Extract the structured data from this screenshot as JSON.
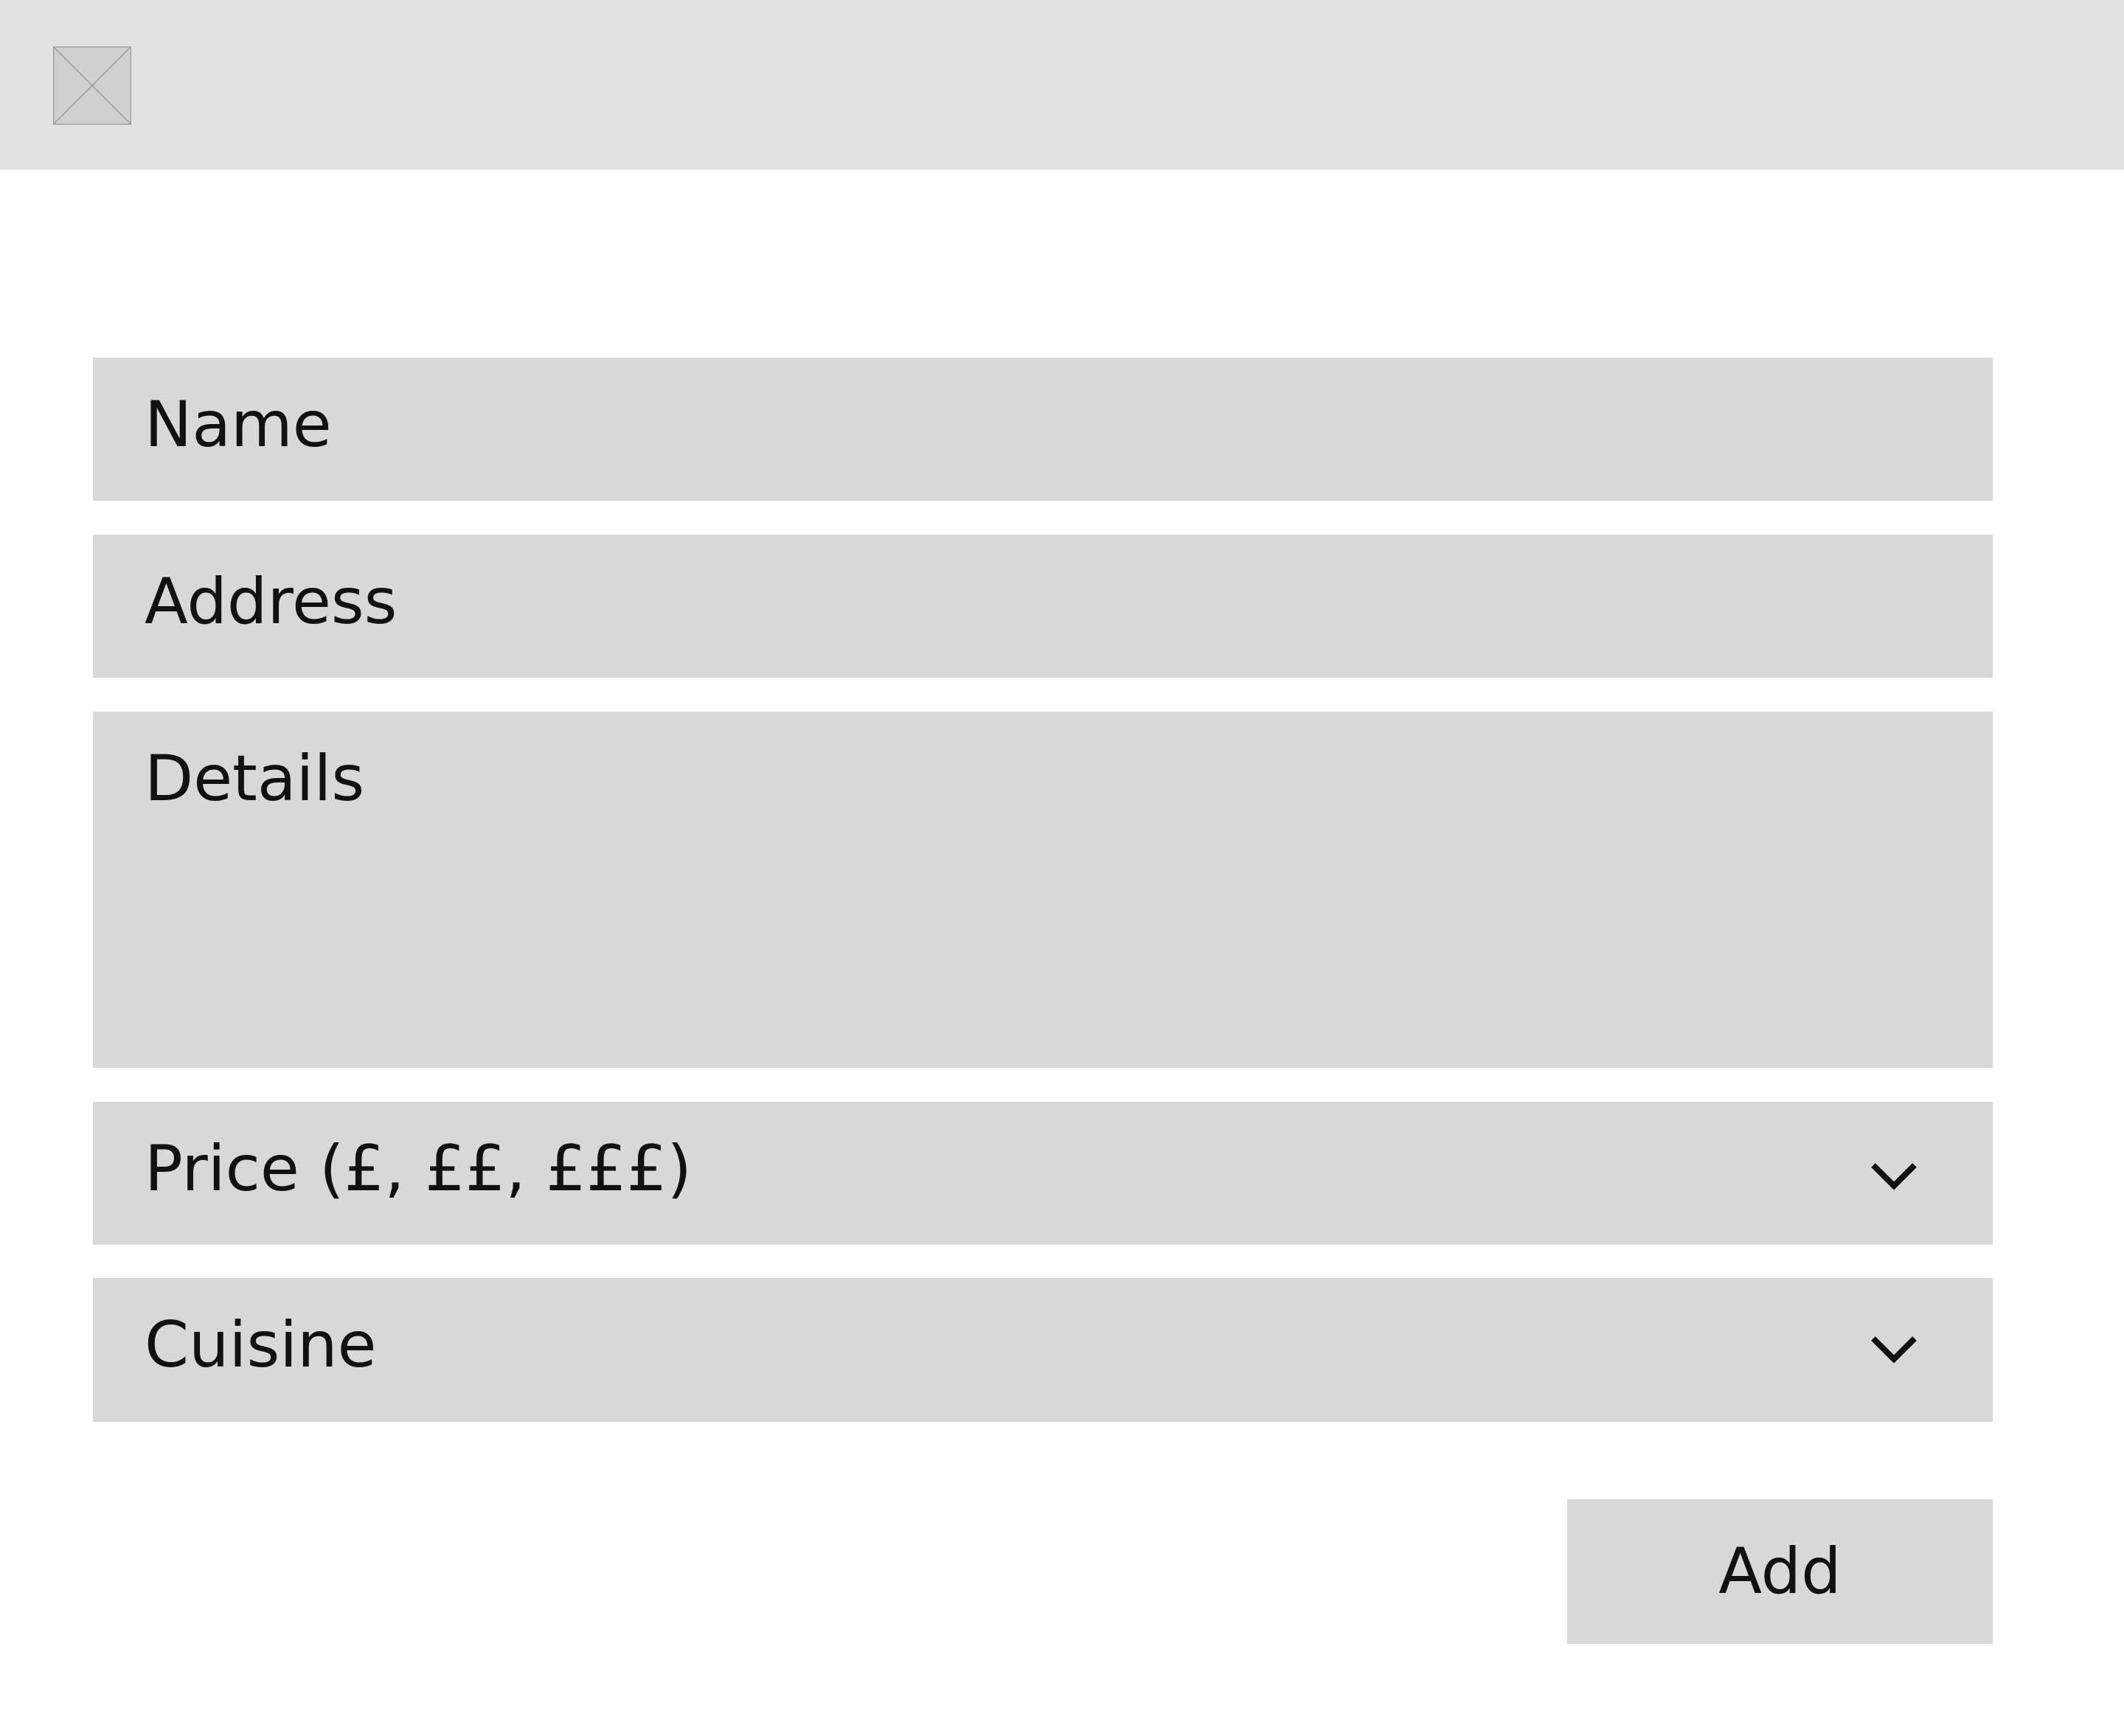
{
  "header": {
    "logo_icon": "image-placeholder-icon"
  },
  "form": {
    "name_placeholder": "Name",
    "address_placeholder": "Address",
    "details_placeholder": "Details",
    "price_placeholder": "Price (£, ££, £££)",
    "cuisine_placeholder": "Cuisine",
    "add_label": "Add"
  },
  "colors": {
    "header_bg": "#e2e2e2",
    "field_bg": "#d8d8d8",
    "text": "#111111"
  }
}
